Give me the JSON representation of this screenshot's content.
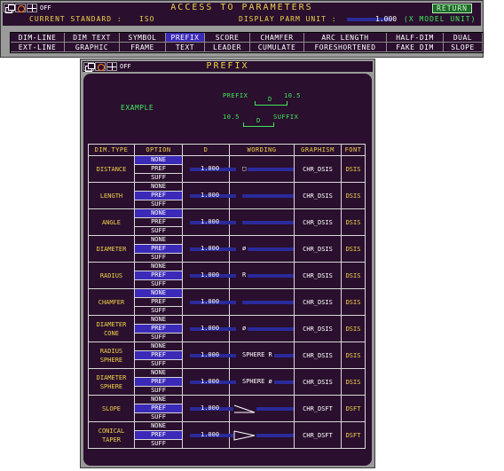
{
  "top": {
    "title": "ACCESS TO PARAMETERS",
    "return": "RETURN",
    "off": "OFF",
    "std_label": "CURRENT STANDARD :",
    "std_value": "ISO",
    "unit_label": "DISPLAY PARM UNIT :",
    "unit_value": "1.000",
    "unit_note": "(X MODEL UNIT)",
    "menu_row1": [
      "DIM-LINE",
      "DIM TEXT",
      "SYMBOL",
      "PREFIX",
      "SCORE",
      "CHAMFER",
      "ARC LENGTH",
      "HALF-DIM",
      "DUAL"
    ],
    "menu_row2": [
      "EXT-LINE",
      "GRAPHIC",
      "FRAME",
      "TEXT",
      "LEADER",
      "CUMULATE",
      "FORESHORTENED",
      "FAKE DIM",
      "SLOPE"
    ],
    "selected": "PREFIX"
  },
  "prefix": {
    "title": "PREFIX",
    "off": "OFF",
    "example": {
      "label": "EXAMPLE",
      "prefix_word": "PREFIX",
      "d1": "D",
      "val1": "10.5",
      "val2": "10.5",
      "d2": "D",
      "suffix_word": "SUFFIX"
    },
    "headers": [
      "DIM.TYPE",
      "OPTION",
      "D",
      "WORDING",
      "GRAPHISM",
      "FONT"
    ],
    "options": [
      "NONE",
      "PREF",
      "SUFF"
    ],
    "rows": [
      {
        "type": "DISTANCE",
        "sel": 0,
        "d": "1.000",
        "wording": "□",
        "graphism": "CHR_DSIS",
        "font": "DSIS"
      },
      {
        "type": "LENGTH",
        "sel": 1,
        "d": "1.000",
        "wording": "",
        "graphism": "CHR_DSIS",
        "font": "DSIS"
      },
      {
        "type": "ANGLE",
        "sel": 0,
        "d": "1.000",
        "wording": "",
        "graphism": "CHR_DSIS",
        "font": "DSIS"
      },
      {
        "type": "DIAMETER",
        "sel": 1,
        "d": "1.000",
        "wording": "ø",
        "graphism": "CHR_DSIS",
        "font": "DSIS"
      },
      {
        "type": "RADIUS",
        "sel": 1,
        "d": "1.000",
        "wording": "R",
        "graphism": "CHR_DSIS",
        "font": "DSIS"
      },
      {
        "type": "CHAMFER",
        "sel": 0,
        "d": "1.000",
        "wording": "",
        "graphism": "CHR_DSIS",
        "font": "DSIS"
      },
      {
        "type": "DIAMETER CONE",
        "sel": 1,
        "d": "1.000",
        "wording": "ø",
        "graphism": "CHR_DSIS",
        "font": "DSIS"
      },
      {
        "type": "RADIUS SPHERE",
        "sel": 1,
        "d": "1.000",
        "wording": "SPHERE R",
        "graphism": "CHR_DSIS",
        "font": "DSIS"
      },
      {
        "type": "DIAMETER SPHERE",
        "sel": 1,
        "d": "1.000",
        "wording": "SPHERE ø",
        "graphism": "CHR_DSIS",
        "font": "DSIS"
      },
      {
        "type": "SLOPE",
        "sel": 1,
        "d": "1.000",
        "wording": "",
        "graphism": "CHR_DSFT",
        "font": "DSFT"
      },
      {
        "type": "CONICAL TAPER",
        "sel": 1,
        "d": "1.000",
        "wording": "",
        "graphism": "CHR_DSFT",
        "font": "DSFT"
      }
    ]
  }
}
